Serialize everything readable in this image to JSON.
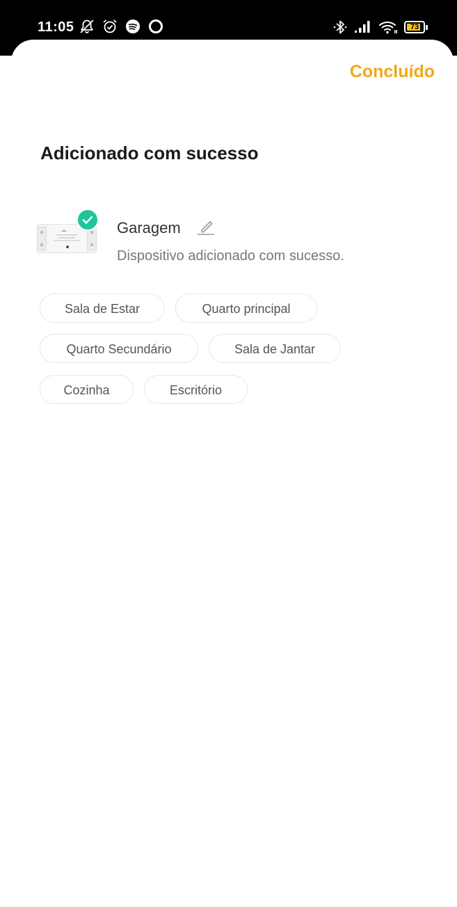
{
  "status_bar": {
    "time": "11:05",
    "battery_level": "73",
    "battery_fraction": 0.73,
    "left_icons": [
      "notifications-off-icon",
      "alarm-icon",
      "spotify-icon",
      "circle-app-icon"
    ],
    "right_icons": [
      "bluetooth-icon",
      "cellular-signal-icon",
      "wifi-icon",
      "battery-icon"
    ],
    "battery_color": "#f5c518"
  },
  "header": {
    "done_label": "Concluído",
    "accent_color": "#f0a818"
  },
  "main": {
    "title": "Adicionado com sucesso",
    "device": {
      "name": "Garagem",
      "message": "Dispositivo adicionado com sucesso.",
      "check_color": "#1fc59a",
      "image_icon": "smart-switch-device-image",
      "edit_icon": "pencil-edit-icon"
    },
    "rooms": [
      {
        "label": "Sala de Estar"
      },
      {
        "label": "Quarto principal"
      },
      {
        "label": "Quarto Secundário"
      },
      {
        "label": "Sala de Jantar"
      },
      {
        "label": "Cozinha"
      },
      {
        "label": "Escritório"
      }
    ]
  }
}
